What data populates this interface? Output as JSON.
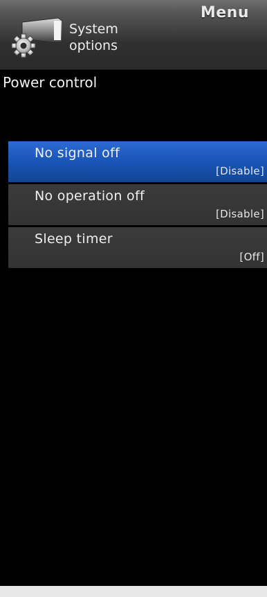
{
  "header": {
    "menu_label": "Menu",
    "category_line1": "System",
    "category_line2": "options",
    "category_icon": "gear-icon"
  },
  "section_title": "Power control",
  "items": [
    {
      "label": "No signal off",
      "value": "[Disable]",
      "selected": true
    },
    {
      "label": "No operation off",
      "value": "[Disable]",
      "selected": false
    },
    {
      "label": "Sleep timer",
      "value": "[Off]",
      "selected": false
    }
  ],
  "colors": {
    "selected_bar": "#1b56b9",
    "item_bar": "#363636",
    "background": "#000000"
  }
}
